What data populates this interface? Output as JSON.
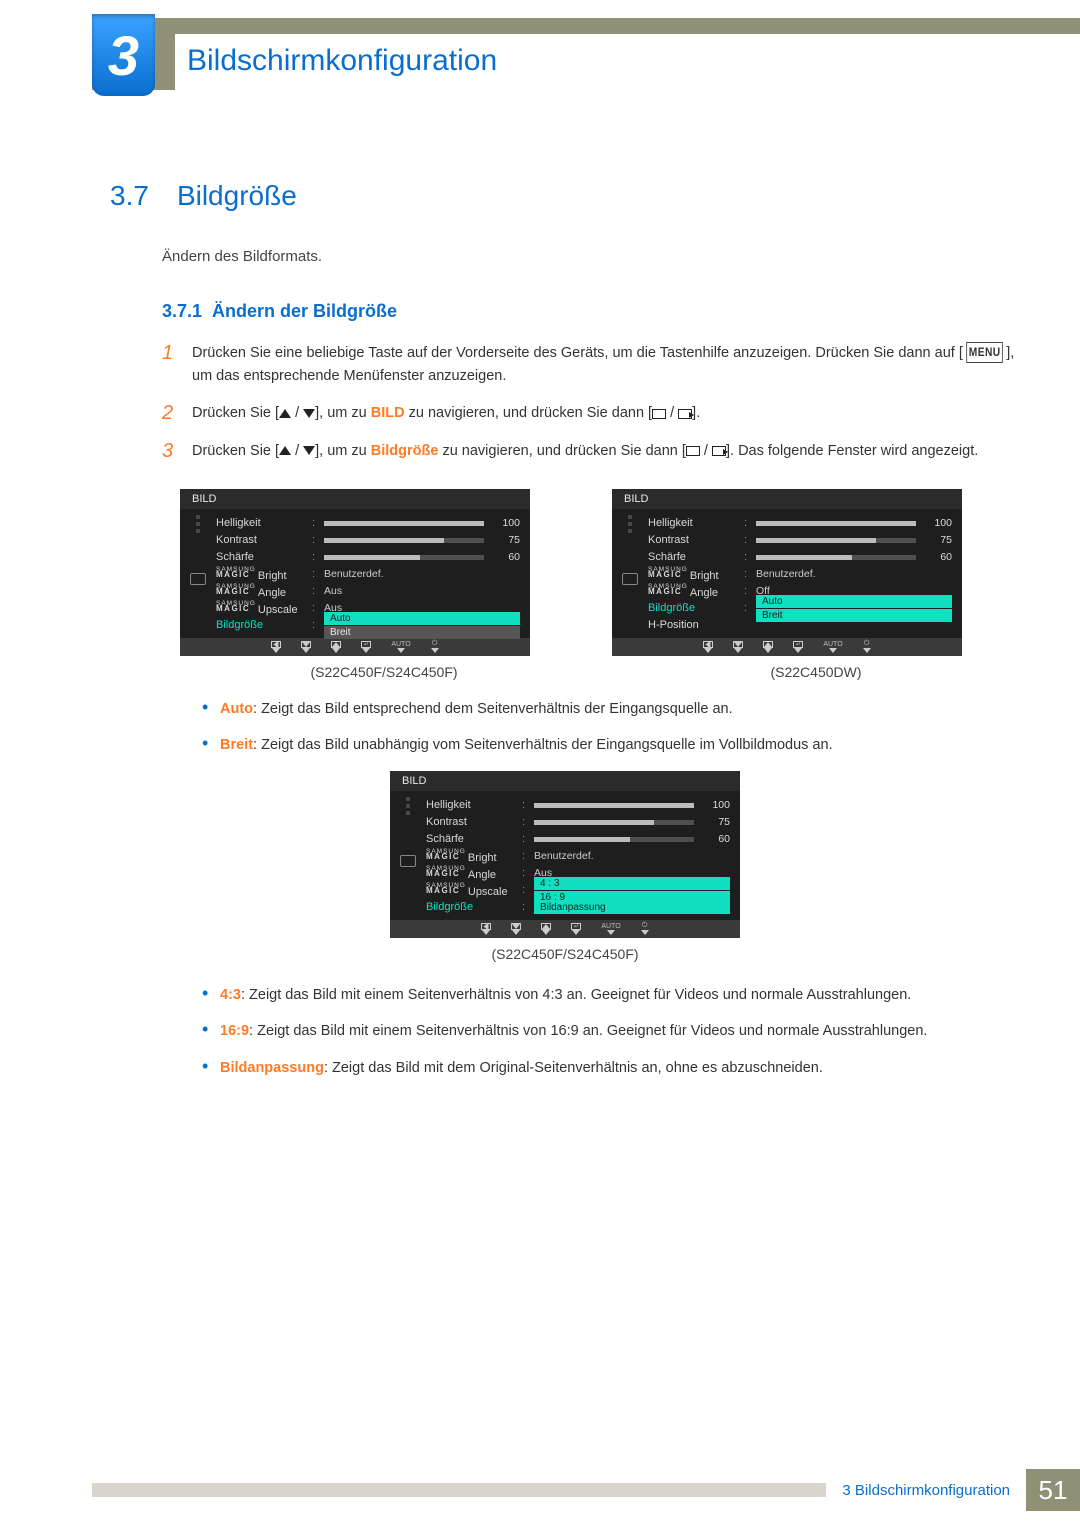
{
  "chapter": {
    "num": "3",
    "title": "Bildschirmkonfiguration"
  },
  "section": {
    "num": "3.7",
    "title": "Bildgröße"
  },
  "intro": "Ändern des Bildformats.",
  "subsection": {
    "num": "3.7.1",
    "title": "Ändern der Bildgröße"
  },
  "steps": {
    "s1": "Drücken Sie eine beliebige Taste auf der Vorderseite des Geräts, um die Tastenhilfe anzuzeigen. Drücken Sie dann auf [",
    "s1b": "], um das entsprechende Menüfenster anzuzeigen.",
    "s2a": "Drücken Sie [",
    "s2b": "], um zu ",
    "s2c": "BILD",
    "s2d": " zu navigieren, und drücken Sie dann [",
    "s2e": "].",
    "s3a": "Drücken Sie [",
    "s3b": "], um zu ",
    "s3c": "Bildgröße",
    "s3d": " zu navigieren, und drücken Sie dann [",
    "s3e": "]. Das folgende Fenster wird angezeigt.",
    "menuLabel": "MENU"
  },
  "osdLabels": {
    "panelTitle": "BILD",
    "helligkeit": "Helligkeit",
    "kontrast": "Kontrast",
    "schaerfe": "Schärfe",
    "bright": "Bright",
    "angle": "Angle",
    "upscale": "Upscale",
    "bildgroesse": "Bildgröße",
    "hposition": "H-Position",
    "benutzerdef": "Benutzerdef.",
    "aus": "Aus",
    "off": "Off",
    "auto": "Auto",
    "breit": "Breit",
    "r43": "4 : 3",
    "r169": "16 : 9",
    "bildanpassung": "Bildanpassung",
    "v100": "100",
    "v75": "75",
    "v60": "60",
    "footAuto": "AUTO"
  },
  "captions": {
    "cap1": "(S22C450F/S24C450F)",
    "cap2": "(S22C450DW)",
    "cap3": "(S22C450F/S24C450F)"
  },
  "bullets1": {
    "autoLabel": "Auto",
    "autoText": ": Zeigt das Bild entsprechend dem Seitenverhältnis der Eingangsquelle an.",
    "breitLabel": "Breit",
    "breitText": ": Zeigt das Bild unabhängig vom Seitenverhältnis der Eingangsquelle im Vollbildmodus an."
  },
  "bullets2": {
    "r43Label": "4:3",
    "r43Text": ": Zeigt das Bild mit einem Seitenverhältnis von 4:3 an. Geeignet für Videos und normale Ausstrahlungen.",
    "r169Label": "16:9",
    "r169Text": ": Zeigt das Bild mit einem Seitenverhältnis von 16:9 an. Geeignet für Videos und normale Ausstrahlungen.",
    "bpLabel": "Bildanpassung",
    "bpText": ": Zeigt das Bild mit dem Original-Seitenverhältnis an, ohne es abzuschneiden."
  },
  "footer": {
    "label": "3 Bildschirmkonfiguration",
    "page": "51"
  }
}
